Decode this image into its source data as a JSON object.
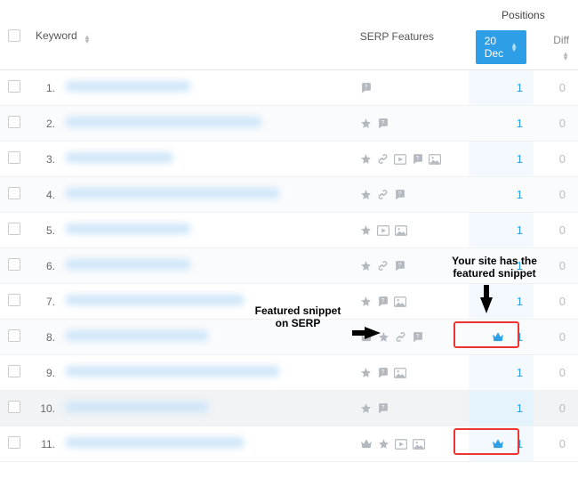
{
  "columns": {
    "keyword": "Keyword",
    "serp": "SERP Features",
    "positions_group": "Positions",
    "date": "20 Dec",
    "diff": "Diff"
  },
  "annotations": {
    "left": "Featured snippet\non SERP",
    "right": "Your site has the\nfeatured snippet"
  },
  "rows": [
    {
      "idx": "1.",
      "kw_w": 140,
      "icons": [
        "faq"
      ],
      "pos": "1",
      "diff": "0",
      "crown": false
    },
    {
      "idx": "2.",
      "kw_w": 220,
      "icons": [
        "star",
        "faq"
      ],
      "pos": "1",
      "diff": "0",
      "crown": false
    },
    {
      "idx": "3.",
      "kw_w": 120,
      "icons": [
        "star",
        "link",
        "video",
        "faq",
        "img"
      ],
      "pos": "1",
      "diff": "0",
      "crown": false
    },
    {
      "idx": "4.",
      "kw_w": 240,
      "icons": [
        "star",
        "link",
        "faq"
      ],
      "pos": "1",
      "diff": "0",
      "crown": false
    },
    {
      "idx": "5.",
      "kw_w": 140,
      "icons": [
        "star",
        "video",
        "img"
      ],
      "pos": "1",
      "diff": "0",
      "crown": false
    },
    {
      "idx": "6.",
      "kw_w": 140,
      "icons": [
        "star",
        "link",
        "faq"
      ],
      "pos": "1",
      "diff": "0",
      "crown": false
    },
    {
      "idx": "7.",
      "kw_w": 200,
      "icons": [
        "star",
        "faq",
        "img"
      ],
      "pos": "1",
      "diff": "0",
      "crown": false
    },
    {
      "idx": "8.",
      "kw_w": 160,
      "icons": [
        "crown",
        "star",
        "link",
        "faq"
      ],
      "pos": "1",
      "diff": "0",
      "crown": true
    },
    {
      "idx": "9.",
      "kw_w": 240,
      "icons": [
        "star",
        "faq",
        "img"
      ],
      "pos": "1",
      "diff": "0",
      "crown": false
    },
    {
      "idx": "10.",
      "kw_w": 160,
      "icons": [
        "star",
        "faq"
      ],
      "pos": "1",
      "diff": "0",
      "crown": false
    },
    {
      "idx": "11.",
      "kw_w": 200,
      "icons": [
        "crown",
        "star",
        "video",
        "img"
      ],
      "pos": "1",
      "diff": "0",
      "crown": true
    }
  ]
}
